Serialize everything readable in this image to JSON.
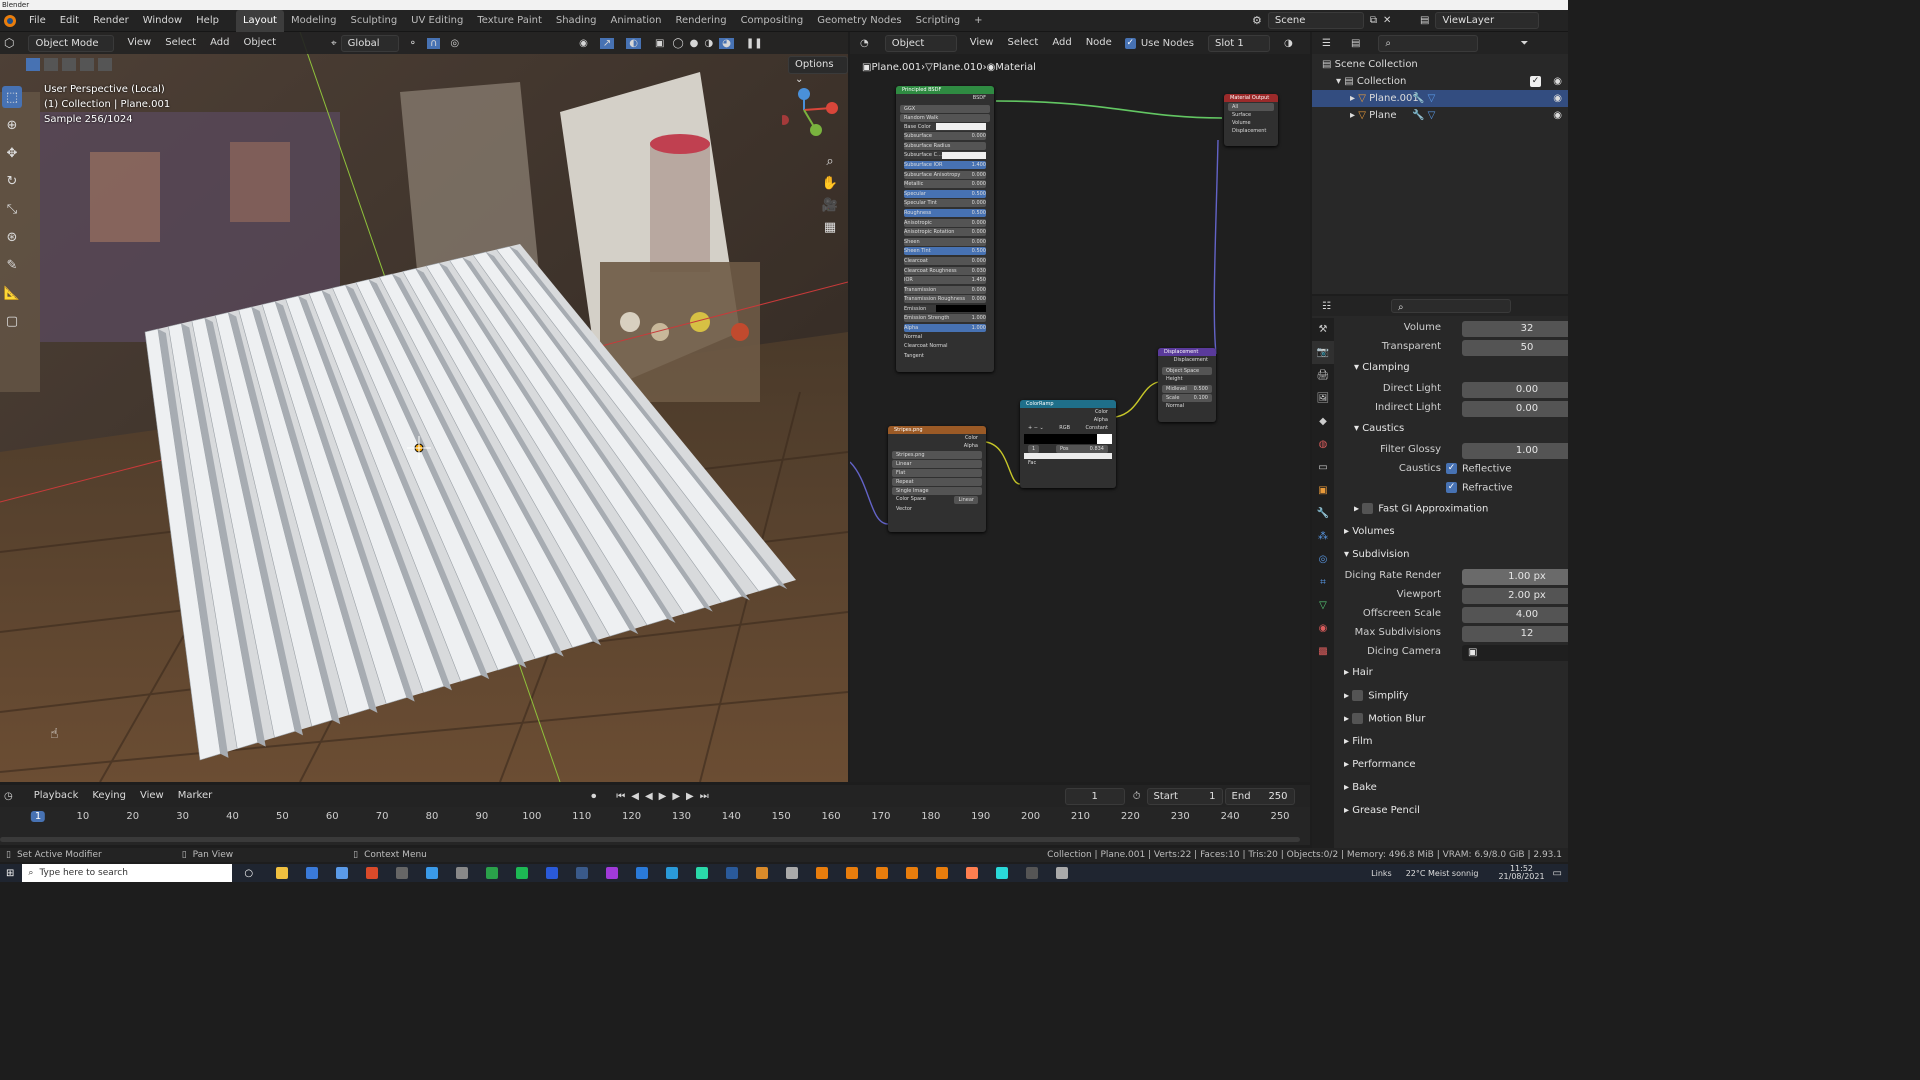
{
  "window": {
    "title": "Blender"
  },
  "menu": [
    "File",
    "Edit",
    "Render",
    "Window",
    "Help"
  ],
  "workspaces": [
    "Layout",
    "Modeling",
    "Sculpting",
    "UV Editing",
    "Texture Paint",
    "Shading",
    "Animation",
    "Rendering",
    "Compositing",
    "Geometry Nodes",
    "Scripting"
  ],
  "active_workspace": "Layout",
  "scene": "Scene",
  "view_layer": "ViewLayer",
  "viewport": {
    "mode": "Object Mode",
    "menus": [
      "View",
      "Select",
      "Add",
      "Object"
    ],
    "orientation": "Global",
    "options": "Options",
    "info_line1": "User Perspective (Local)",
    "info_line2": "(1) Collection | Plane.001",
    "info_line3": "Sample 256/1024"
  },
  "node_editor": {
    "type": "Object",
    "menus": [
      "View",
      "Select",
      "Add",
      "Node"
    ],
    "use_nodes": "Use Nodes",
    "slot": "Slot 1",
    "breadcrumb": [
      "Plane.001",
      "Plane.010",
      "Material"
    ],
    "bsdf": {
      "title": "Principled BSDF",
      "output": "BSDF",
      "dist": "GGX",
      "sss": "Random Walk",
      "rows": [
        {
          "label": "Base Color",
          "value": "",
          "style": "white"
        },
        {
          "label": "Subsurface",
          "value": "0.000",
          "style": "grey"
        },
        {
          "label": "Subsurface Radius",
          "value": "",
          "style": "dd"
        },
        {
          "label": "Subsurface C...",
          "value": "",
          "style": "white"
        },
        {
          "label": "Subsurface IOR",
          "value": "1.400",
          "style": "blue"
        },
        {
          "label": "Subsurface Anisotropy",
          "value": "0.000",
          "style": "grey"
        },
        {
          "label": "Metallic",
          "value": "0.000",
          "style": "grey"
        },
        {
          "label": "Specular",
          "value": "0.500",
          "style": "blue"
        },
        {
          "label": "Specular Tint",
          "value": "0.000",
          "style": "grey"
        },
        {
          "label": "Roughness",
          "value": "0.500",
          "style": "blue"
        },
        {
          "label": "Anisotropic",
          "value": "0.000",
          "style": "grey"
        },
        {
          "label": "Anisotropic Rotation",
          "value": "0.000",
          "style": "grey"
        },
        {
          "label": "Sheen",
          "value": "0.000",
          "style": "grey"
        },
        {
          "label": "Sheen Tint",
          "value": "0.500",
          "style": "blue"
        },
        {
          "label": "Clearcoat",
          "value": "0.000",
          "style": "grey"
        },
        {
          "label": "Clearcoat Roughness",
          "value": "0.030",
          "style": "grey"
        },
        {
          "label": "IOR",
          "value": "1.450",
          "style": "grey"
        },
        {
          "label": "Transmission",
          "value": "0.000",
          "style": "grey"
        },
        {
          "label": "Transmission Roughness",
          "value": "0.000",
          "style": "grey"
        },
        {
          "label": "Emission",
          "value": "",
          "style": "dark"
        },
        {
          "label": "Emission Strength",
          "value": "1.000",
          "style": "grey"
        },
        {
          "label": "Alpha",
          "value": "1.000",
          "style": "blue"
        },
        {
          "label": "Normal",
          "value": "",
          "style": "none"
        },
        {
          "label": "Clearcoat Normal",
          "value": "",
          "style": "none"
        },
        {
          "label": "Tangent",
          "value": "",
          "style": "none"
        }
      ]
    },
    "output": {
      "title": "Material Output",
      "target": "All",
      "sockets": [
        "Surface",
        "Volume",
        "Displacement"
      ]
    },
    "displacement": {
      "title": "Displacement",
      "out": "Displacement",
      "space": "Object Space",
      "rows": [
        {
          "label": "Height",
          "value": ""
        },
        {
          "label": "Midlevel",
          "value": "0.500"
        },
        {
          "label": "Scale",
          "value": "0.100"
        },
        {
          "label": "Normal",
          "value": ""
        }
      ]
    },
    "colorramp": {
      "title": "ColorRamp",
      "outs": [
        "Color",
        "Alpha"
      ],
      "mode": "RGB",
      "interp": "Constant",
      "pos_index": "1",
      "pos_label": "Pos",
      "pos_value": "0.834",
      "fac": "Fac"
    },
    "image": {
      "title": "Stripes.png",
      "outs": [
        "Color",
        "Alpha"
      ],
      "file": "Stripes.png",
      "interp": "Linear",
      "proj": "Flat",
      "ext": "Repeat",
      "source": "Single Image",
      "cs_label": "Color Space",
      "cs_value": "Linear",
      "vector": "Vector"
    }
  },
  "outliner": {
    "items": [
      {
        "label": "Scene Collection",
        "depth": 0
      },
      {
        "label": "Collection",
        "depth": 1
      },
      {
        "label": "Plane.001",
        "depth": 2
      },
      {
        "label": "Plane",
        "depth": 2
      }
    ]
  },
  "properties": {
    "rows": [
      {
        "type": "field",
        "label": "Volume",
        "value": "32"
      },
      {
        "type": "field",
        "label": "Transparent",
        "value": "50"
      },
      {
        "type": "panel",
        "label": "Clamping",
        "open": true,
        "depth": 1
      },
      {
        "type": "field",
        "label": "Direct Light",
        "value": "0.00"
      },
      {
        "type": "field",
        "label": "Indirect Light",
        "value": "0.00"
      },
      {
        "type": "panel",
        "label": "Caustics",
        "open": true,
        "depth": 1
      },
      {
        "type": "field",
        "label": "Filter Glossy",
        "value": "1.00"
      },
      {
        "type": "check",
        "label": "Caustics",
        "value": "Reflective"
      },
      {
        "type": "check",
        "label": "",
        "value": "Refractive"
      },
      {
        "type": "panel",
        "label": "Fast GI Approximation",
        "open": false,
        "depth": 1,
        "checkbox": true
      },
      {
        "type": "panel",
        "label": "Volumes",
        "open": false,
        "depth": 0
      },
      {
        "type": "panel",
        "label": "Subdivision",
        "open": true,
        "depth": 0
      },
      {
        "type": "field",
        "label": "Dicing Rate Render",
        "value": "1.00 px"
      },
      {
        "type": "field",
        "label": "Viewport",
        "value": "2.00 px"
      },
      {
        "type": "field",
        "label": "Offscreen Scale",
        "value": "4.00"
      },
      {
        "type": "field",
        "label": "Max Subdivisions",
        "value": "12"
      },
      {
        "type": "field",
        "label": "Dicing Camera",
        "value": ""
      },
      {
        "type": "panel",
        "label": "Hair",
        "open": false,
        "depth": 0
      },
      {
        "type": "panel",
        "label": "Simplify",
        "open": false,
        "depth": 0,
        "checkbox": true
      },
      {
        "type": "panel",
        "label": "Motion Blur",
        "open": false,
        "depth": 0,
        "checkbox": true
      },
      {
        "type": "panel",
        "label": "Film",
        "open": false,
        "depth": 0
      },
      {
        "type": "panel",
        "label": "Performance",
        "open": false,
        "depth": 0
      },
      {
        "type": "panel",
        "label": "Bake",
        "open": false,
        "depth": 0
      },
      {
        "type": "panel",
        "label": "Grease Pencil",
        "open": false,
        "depth": 0
      }
    ]
  },
  "timeline": {
    "menus": [
      "Playback",
      "Keying",
      "View",
      "Marker"
    ],
    "current_frame": "1",
    "start_label": "Start",
    "start": "1",
    "end_label": "End",
    "end": "250",
    "ticks": [
      "1",
      "10",
      "20",
      "30",
      "40",
      "50",
      "60",
      "70",
      "80",
      "90",
      "100",
      "110",
      "120",
      "130",
      "140",
      "150",
      "160",
      "170",
      "180",
      "190",
      "200",
      "210",
      "220",
      "230",
      "240",
      "250"
    ]
  },
  "statusbar": {
    "left": "Set Active Modifier",
    "middle": "Pan View",
    "right_ctx": "Context Menu",
    "stats": "Collection | Plane.001 | Verts:22 | Faces:10 | Tris:20 | Objects:0/2 | Memory: 496.8 MiB | VRAM: 6.9/8.0 GiB | 2.93.1"
  },
  "taskbar": {
    "search": "Type here to search",
    "weather": "22°C  Meist sonnig",
    "links": "Links",
    "time": "11:52",
    "date": "21/08/2021"
  }
}
